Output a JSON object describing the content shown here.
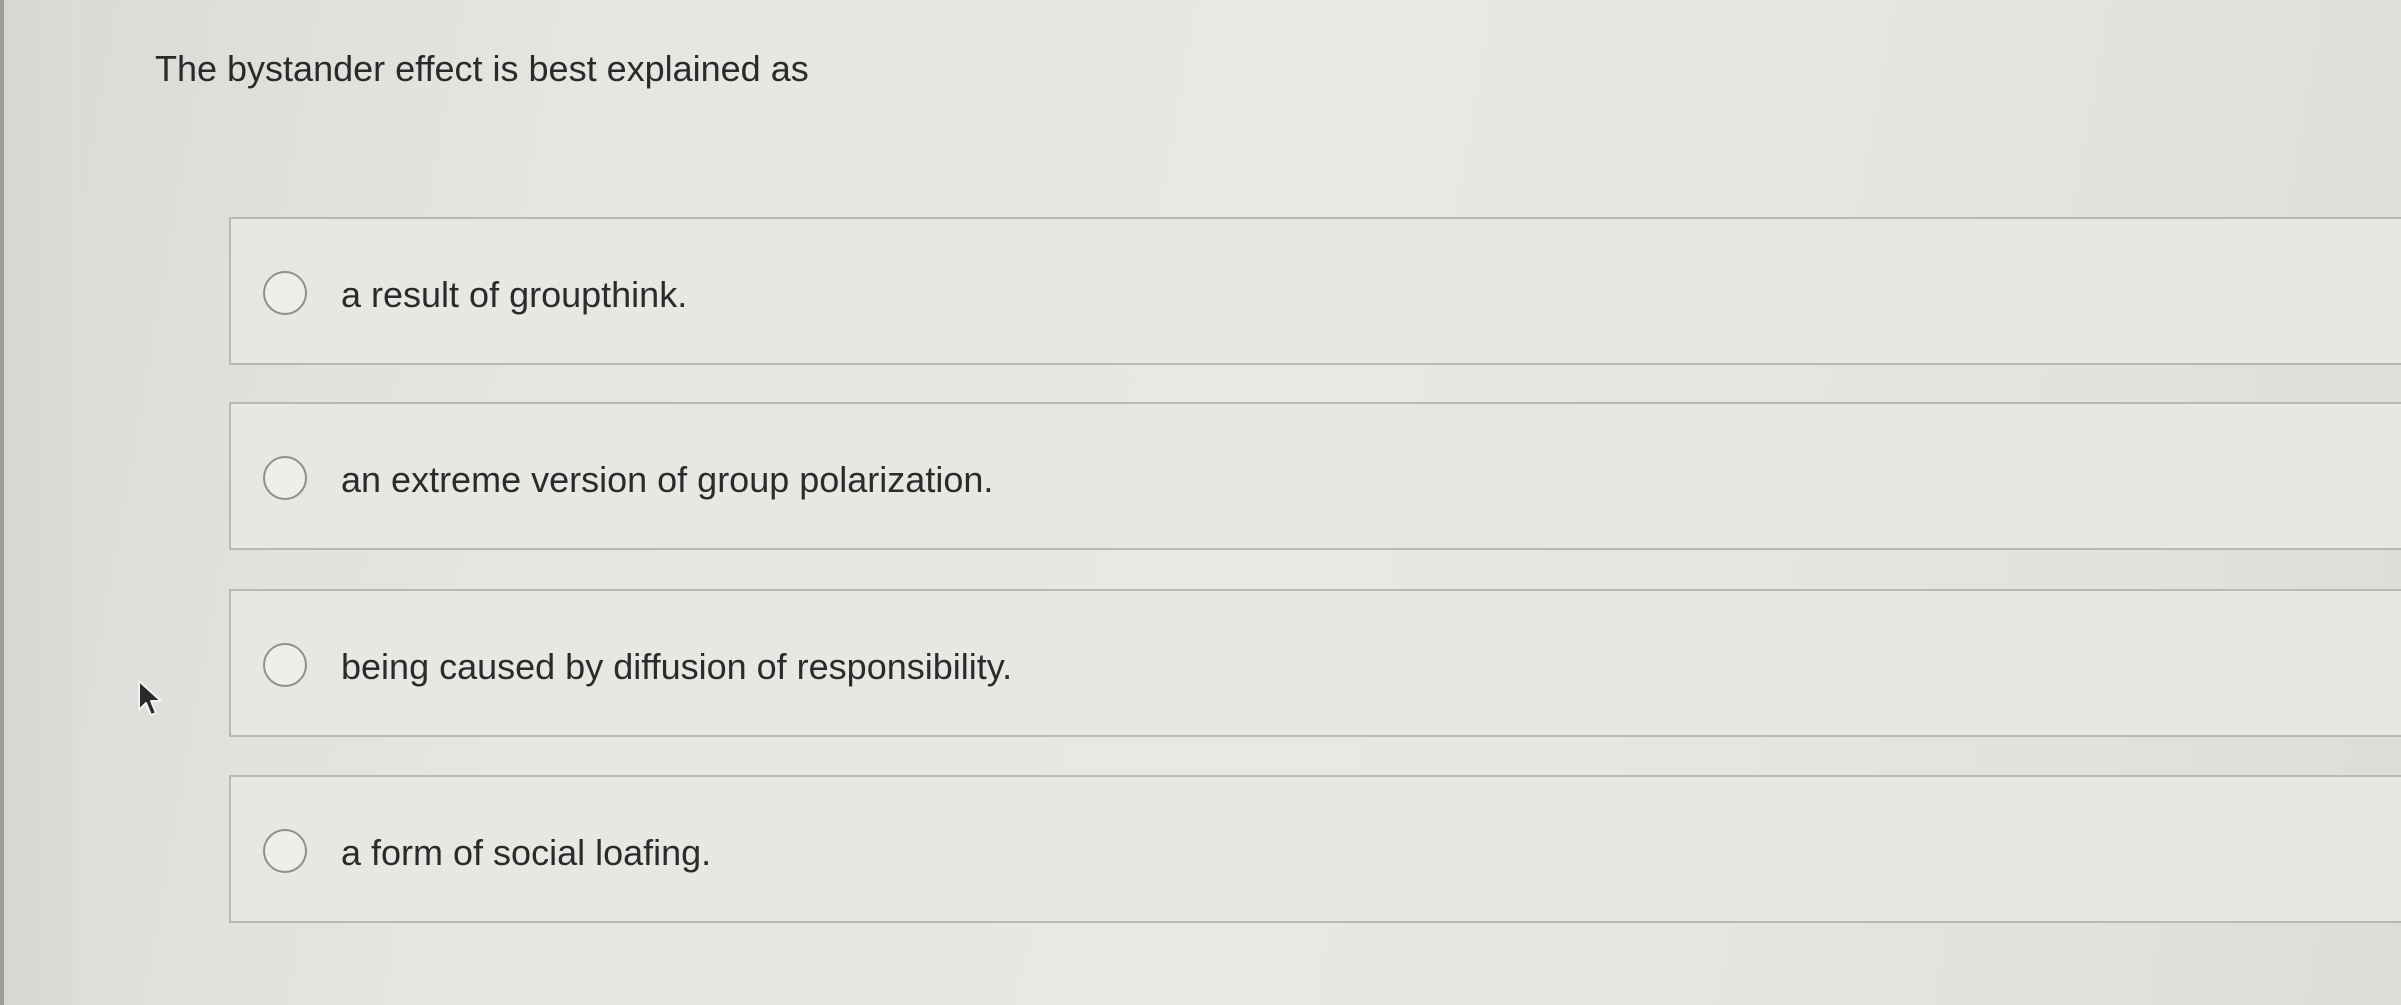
{
  "question": {
    "text": "The bystander effect is best explained as"
  },
  "options": [
    {
      "label": "a result of groupthink.",
      "selected": false
    },
    {
      "label": "an extreme version of group polarization.",
      "selected": false
    },
    {
      "label": "being caused by diffusion of responsibility.",
      "selected": false
    },
    {
      "label": "a form of social loafing.",
      "selected": false
    }
  ],
  "colors": {
    "background": "#e4e5e0",
    "option_border": "#b8b9b4",
    "text": "#2b2b2b",
    "radio_border": "#8f908c"
  },
  "icons": {
    "radio": "radio-unchecked-icon",
    "cursor": "mouse-pointer-icon"
  }
}
